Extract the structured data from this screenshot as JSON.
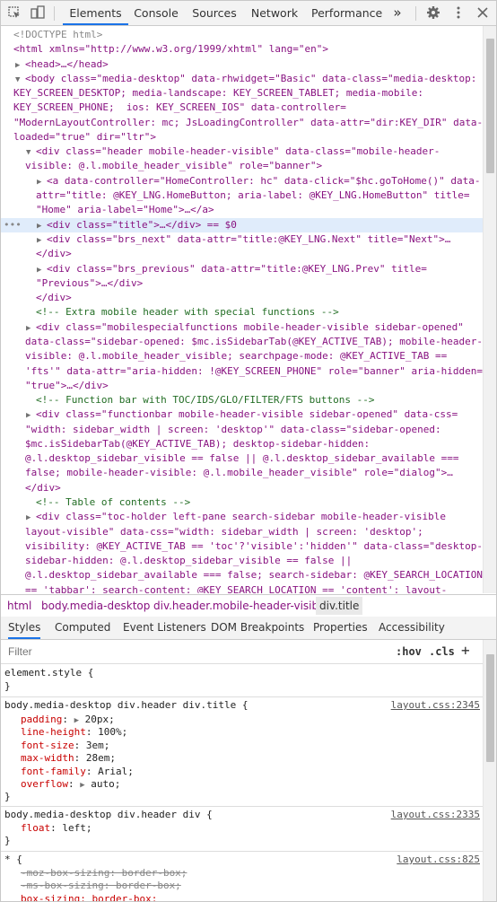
{
  "toolbar": {
    "tabs": [
      "Elements",
      "Console",
      "Sources",
      "Network",
      "Performance"
    ],
    "more": "»",
    "icons": [
      "inspect-icon",
      "device-icon",
      "gear-icon",
      "kebab-menu-icon",
      "close-icon"
    ]
  },
  "tree": {
    "doctype": "<!DOCTYPE html>",
    "html_open": "<html xmlns=\"http://www.w3.org/1999/xhtml\" lang=\"en\">",
    "head": "<head>…</head>",
    "body_1": "<body class=\"media-desktop\" data-rhwidget=\"Basic\" data-class=\"media-desktop:",
    "body_2": "KEY_SCREEN_DESKTOP; media-landscape: KEY_SCREEN_TABLET; media-mobile:",
    "body_3": "KEY_SCREEN_PHONE;  ios: KEY_SCREEN_IOS\" data-controller=",
    "body_4": "\"ModernLayoutController: mc; JsLoadingController\" data-attr=\"dir:KEY_DIR\" data-",
    "body_5": "loaded=\"true\" dir=\"ltr\">",
    "header_1": "<div class=\"header mobile-header-visible\" data-class=\"mobile-header-",
    "header_2": "visible: @.l.mobile_header_visible\" role=\"banner\">",
    "a_1": "<a data-controller=\"HomeController: hc\" data-click=\"$hc.goToHome()\" data-",
    "a_2": "attr=\"title: @KEY_LNG.HomeButton; aria-label: @KEY_LNG.HomeButton\" title=",
    "a_3": "\"Home\" aria-label=\"Home\">…</a>",
    "title_div": "<div class=\"title\">…</div> == $0",
    "next_1": "<div class=\"brs_next\" data-attr=\"title:@KEY_LNG.Next\" title=\"Next\">…",
    "next_2": "</div>",
    "prev_1": "<div class=\"brs_previous\" data-attr=\"title:@KEY_LNG.Prev\" title=",
    "prev_2": "\"Previous\">…</div>",
    "header_close": "</div>",
    "comment_1": "<!-- Extra mobile header with special functions -->",
    "special_1": "<div class=\"mobilespecialfunctions mobile-header-visible sidebar-opened\"",
    "special_2": "data-class=\"sidebar-opened: $mc.isSidebarTab(@KEY_ACTIVE_TAB); mobile-header-",
    "special_3": "visible: @.l.mobile_header_visible; searchpage-mode: @KEY_ACTIVE_TAB ==",
    "special_4": "'fts'\" data-attr=\"aria-hidden: !@KEY_SCREEN_PHONE\" role=\"banner\" aria-hidden=",
    "special_5": "\"true\">…</div>",
    "comment_2": "<!-- Function bar with TOC/IDS/GLO/FILTER/FTS buttons -->",
    "func_1": "<div class=\"functionbar mobile-header-visible sidebar-opened\" data-css=",
    "func_2": "\"width: sidebar_width | screen: 'desktop'\" data-class=\"sidebar-opened:",
    "func_3": "$mc.isSidebarTab(@KEY_ACTIVE_TAB); desktop-sidebar-hidden:",
    "func_4": "@.l.desktop_sidebar_visible == false || @.l.desktop_sidebar_available ===",
    "func_5": "false; mobile-header-visible: @.l.mobile_header_visible\" role=\"dialog\">…",
    "func_6": "</div>",
    "comment_3": "<!-- Table of contents -->",
    "toc_1": "<div class=\"toc-holder left-pane search-sidebar mobile-header-visible",
    "toc_2": "layout-visible\" data-css=\"width: sidebar_width | screen: 'desktop';",
    "toc_3": "visibility: @KEY_ACTIVE_TAB == 'toc'?'visible':'hidden'\" data-class=\"desktop-",
    "toc_4": "sidebar-hidden: @.l.desktop_sidebar_visible == false ||",
    "toc_5": "@.l.desktop_sidebar_available === false; search-sidebar: @KEY_SEARCH_LOCATION",
    "toc_6": "== 'tabbar'; search-content: @KEY_SEARCH_LOCATION == 'content'; layout-"
  },
  "breadcrumbs": [
    "html",
    "body.media-desktop",
    "div.header.mobile-header-visible",
    "div.title"
  ],
  "styles_tabs": [
    "Styles",
    "Computed",
    "Event Listeners",
    "DOM Breakpoints",
    "Properties",
    "Accessibility"
  ],
  "filter": {
    "placeholder": "Filter",
    "hov": ":hov",
    "cls": ".cls",
    "plus": "+"
  },
  "rules": {
    "element_style": "element.style {",
    "close": "}",
    "r1_selector": "body.media-desktop div.header div.title {",
    "r1_source": "layout.css:2345",
    "r1_props": [
      {
        "name": "padding",
        "value": "20px",
        "expand": true
      },
      {
        "name": "line-height",
        "value": "100%"
      },
      {
        "name": "font-size",
        "value": "3em"
      },
      {
        "name": "max-width",
        "value": "28em"
      },
      {
        "name": "font-family",
        "value": "Arial"
      },
      {
        "name": "overflow",
        "value": "auto",
        "expand": true
      }
    ],
    "r2_selector": "body.media-desktop div.header div {",
    "r2_source": "layout.css:2335",
    "r2_props": [
      {
        "name": "float",
        "value": "left"
      }
    ],
    "r3_selector": "* {",
    "r3_source": "layout.css:825",
    "r3_struck": [
      "-moz-box-sizing: border-box;",
      "-ms-box-sizing: border-box;"
    ],
    "r3_last": "box-sizing: border-box;"
  }
}
